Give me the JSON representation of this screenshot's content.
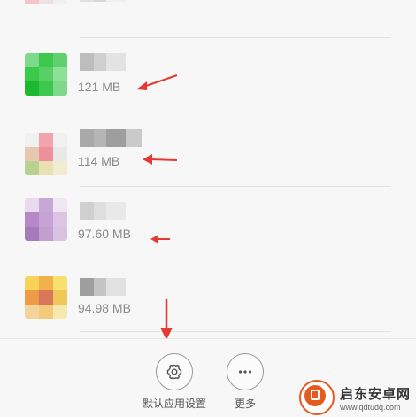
{
  "apps": [
    {
      "size": "",
      "icon_colors": [
        "#f2a0a8",
        "#f4d6dc",
        "#f0f0f0",
        "#f5c3c9",
        "#efe0e3",
        "#f0f0f0",
        "#f7f7f7",
        "#f7f7f7",
        "#f7f7f7"
      ],
      "name_colors": [
        "#e0e0e0",
        "#d8d8d8",
        "#f0f0f0"
      ]
    },
    {
      "size": "121 MB",
      "icon_colors": [
        "#7fd98b",
        "#3cc84c",
        "#5fd16c",
        "#3acb4a",
        "#59d067",
        "#8de096",
        "#1bb92f",
        "#3cc84c",
        "#7fd98b"
      ],
      "name_colors": [
        "#bdbdbd",
        "#cfcfcf",
        "#e3e3e3"
      ]
    },
    {
      "size": "114 MB",
      "icon_colors": [
        "#f0f0f0",
        "#f3a3ad",
        "#f0f0f0",
        "#e6c8b0",
        "#ee8f9a",
        "#e8e8e8",
        "#b9d28f",
        "#e9e1b4",
        "#f0ecd0"
      ],
      "name_colors": [
        "#a9a9a9",
        "#b5b5b5",
        "#9e9e9e",
        "#cacaca"
      ]
    },
    {
      "size": "97.60 MB",
      "icon_colors": [
        "#e9dbef",
        "#c6a8d6",
        "#efe6f2",
        "#b788c8",
        "#c7a3d5",
        "#dbc4e4",
        "#a67bb9",
        "#c1a0d0",
        "#d8c2e2"
      ],
      "name_colors": [
        "#d0d0d0",
        "#dedede",
        "#e9e9e9"
      ]
    },
    {
      "size": "94.98 MB",
      "icon_colors": [
        "#f8d35a",
        "#f2b24a",
        "#f7e06b",
        "#ee9a47",
        "#d9775a",
        "#f0c75a",
        "#f4d39c",
        "#f3c97a",
        "#f5e9b0"
      ],
      "name_colors": [
        "#9e9e9e",
        "#c4c4c4",
        "#e1e1e1"
      ]
    }
  ],
  "bottom_bar": {
    "default_apps_label": "默认应用设置",
    "more_label": "更多"
  },
  "watermark": {
    "title": "启东安卓网",
    "url": "www.qdtudq.com"
  },
  "colors": {
    "arrow": "#e53935",
    "accent": "#e55a1d"
  }
}
